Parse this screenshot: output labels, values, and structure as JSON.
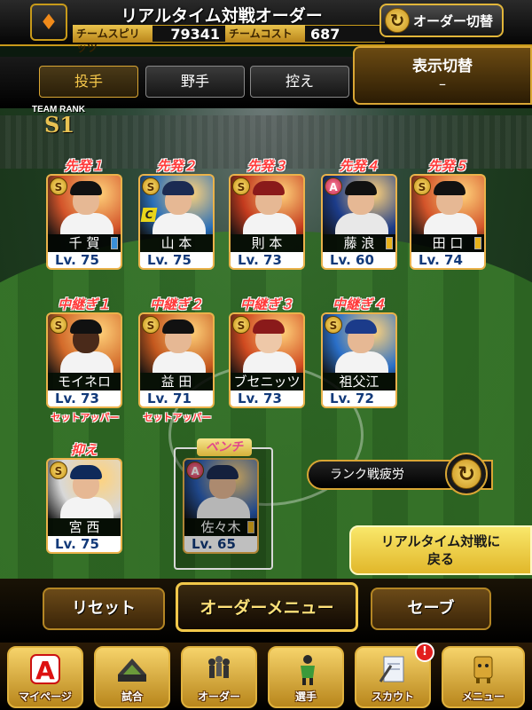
{
  "header": {
    "title": "リアルタイム対戦オーダー",
    "logo_glyph": "♦",
    "team_spirits_label": "チームスピリッツ",
    "team_spirits_value": "79341",
    "team_cost_label": "チームコスト",
    "team_cost_value": "687",
    "order_switch_label": "オーダー切替"
  },
  "tabs": [
    {
      "label": "投手",
      "active": true
    },
    {
      "label": "野手",
      "active": false
    },
    {
      "label": "控え",
      "active": false
    }
  ],
  "display_toggle": {
    "label": "表示切替",
    "value": "–"
  },
  "team_rank": {
    "label": "TEAM RANK",
    "rank": "S1"
  },
  "starters": [
    {
      "role": "先発１",
      "name": "千 賀",
      "level": "Lv. 75",
      "badge": "S",
      "jersey": "#f3f3f3",
      "cap": "#111",
      "bg": "#d3542a",
      "mark": "#3a8fd8"
    },
    {
      "role": "先発２",
      "name": "山 本",
      "level": "Lv. 75",
      "badge": "S",
      "jersey": "#f3f3f3",
      "cap": "#1b2b52",
      "bg": "#2a6fb8",
      "mark": "",
      "captain": "C"
    },
    {
      "role": "先発３",
      "name": "則 本",
      "level": "Lv. 73",
      "badge": "S",
      "jersey": "#f3f3f3",
      "cap": "#8a1a1a",
      "bg": "#c43b1e",
      "mark": ""
    },
    {
      "role": "先発４",
      "name": "藤 浪",
      "level": "Lv. 60",
      "badge": "A",
      "jersey": "#e8e8e8",
      "cap": "#111",
      "bg": "#1c3c8a",
      "mark": "#e8b21a"
    },
    {
      "role": "先発５",
      "name": "田 口",
      "level": "Lv. 74",
      "badge": "S",
      "jersey": "#f3f3f3",
      "cap": "#111",
      "bg": "#d3542a",
      "mark": "#e8b21a"
    }
  ],
  "relievers": [
    {
      "role": "中継ぎ１",
      "name": "モイネロ",
      "level": "Lv. 73",
      "badge": "S",
      "sub": "セットアッパー",
      "jersey": "#f3f3f3",
      "cap": "#111",
      "bg": "#d36a2a",
      "skin": "#4a2a1a"
    },
    {
      "role": "中継ぎ２",
      "name": "益 田",
      "level": "Lv. 71",
      "badge": "S",
      "sub": "セットアッパー",
      "jersey": "#f3f3f3",
      "cap": "#111",
      "bg": "#c4581e",
      "skin": "#e6b894"
    },
    {
      "role": "中継ぎ３",
      "name": "ブセニッツ",
      "level": "Lv. 73",
      "badge": "S",
      "sub": "",
      "jersey": "#f3f3f3",
      "cap": "#8a1a1a",
      "bg": "#d04a20",
      "skin": "#eec8a8"
    },
    {
      "role": "中継ぎ４",
      "name": "祖父江",
      "level": "Lv. 72",
      "badge": "S",
      "sub": "",
      "jersey": "#f3f3f3",
      "cap": "#1b3b8a",
      "bg": "#2a6fc8",
      "skin": "#e6b894"
    }
  ],
  "closer": {
    "role": "抑え",
    "name": "宮 西",
    "level": "Lv. 75",
    "badge": "S",
    "jersey": "#f3f3f3",
    "cap": "#0f2a5a",
    "bg": "#d8d8d8",
    "skin": "#e6b894"
  },
  "bench": {
    "role": "ベンチ",
    "name": "佐々木",
    "level": "Lv. 65",
    "badge": "A",
    "jersey": "#f3f3f3",
    "cap": "#1b2b52",
    "bg": "#2a5fb8",
    "skin": "#e6b894",
    "mark": "#e8b21a"
  },
  "rank_fatigue_label": "ランク戦疲労",
  "return_button": "リアルタイム対戦に\n戻る",
  "actions": {
    "reset": "リセット",
    "order_menu": "オーダーメニュー",
    "save": "セーブ"
  },
  "nav": [
    {
      "label": "マイページ",
      "icon": "a-letter-icon"
    },
    {
      "label": "試合",
      "icon": "stadium-icon"
    },
    {
      "label": "オーダー",
      "icon": "players-icon"
    },
    {
      "label": "選手",
      "icon": "player-icon"
    },
    {
      "label": "スカウト",
      "icon": "scout-icon",
      "notification": "!"
    },
    {
      "label": "メニュー",
      "icon": "menu-icon"
    }
  ],
  "colors": {
    "gold": "#d9a634",
    "role_red": "#ff3b3b",
    "level_blue": "#123a7a"
  }
}
